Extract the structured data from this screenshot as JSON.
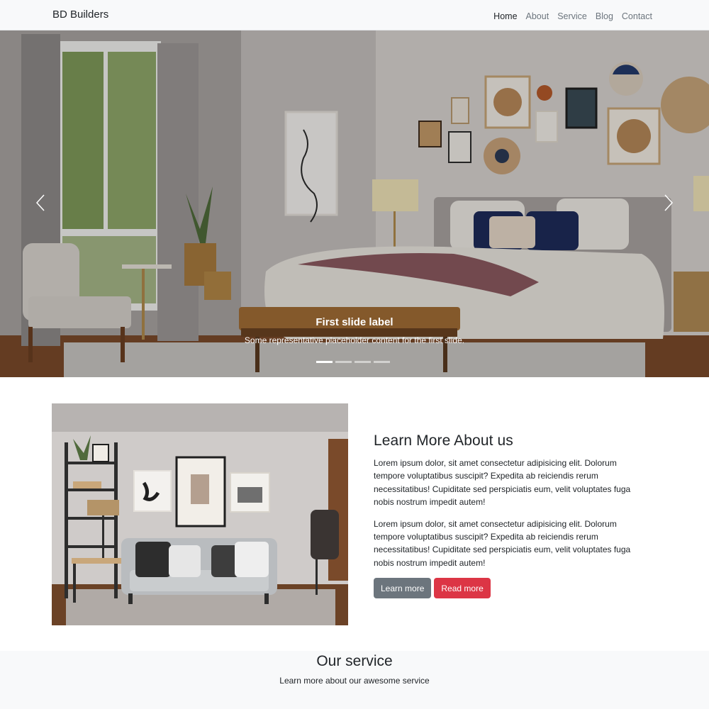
{
  "navbar": {
    "brand": "BD Builders",
    "links": [
      "Home",
      "About",
      "Service",
      "Blog",
      "Contact"
    ],
    "active": "Home"
  },
  "carousel": {
    "caption_title": "First slide label",
    "caption_text": "Some representative placeholder content for the first slide.",
    "slide_count": 4,
    "active_slide": 1,
    "prev_icon": "chevron-left-icon",
    "next_icon": "chevron-right-icon"
  },
  "about": {
    "heading": "Learn More About us",
    "paragraphs": [
      "Lorem ipsum dolor, sit amet consectetur adipisicing elit. Dolorum tempore voluptatibus suscipit? Expedita ab reiciendis rerum necessitatibus! Cupiditate sed perspiciatis eum, velit voluptates fuga nobis nostrum impedit autem!",
      "Lorem ipsum dolor, sit amet consectetur adipisicing elit. Dolorum tempore voluptatibus suscipit? Expedita ab reiciendis rerum necessitatibus! Cupiditate sed perspiciatis eum, velit voluptates fuga nobis nostrum impedit autem!"
    ],
    "learn_more_label": "Learn more",
    "read_more_label": "Read more"
  },
  "service": {
    "heading": "Our service",
    "subheading": "Learn more about our awesome service"
  },
  "colors": {
    "navbar_bg": "#f8f9fa",
    "btn_secondary": "#6c757d",
    "btn_danger": "#dc3545",
    "text": "#212529"
  }
}
